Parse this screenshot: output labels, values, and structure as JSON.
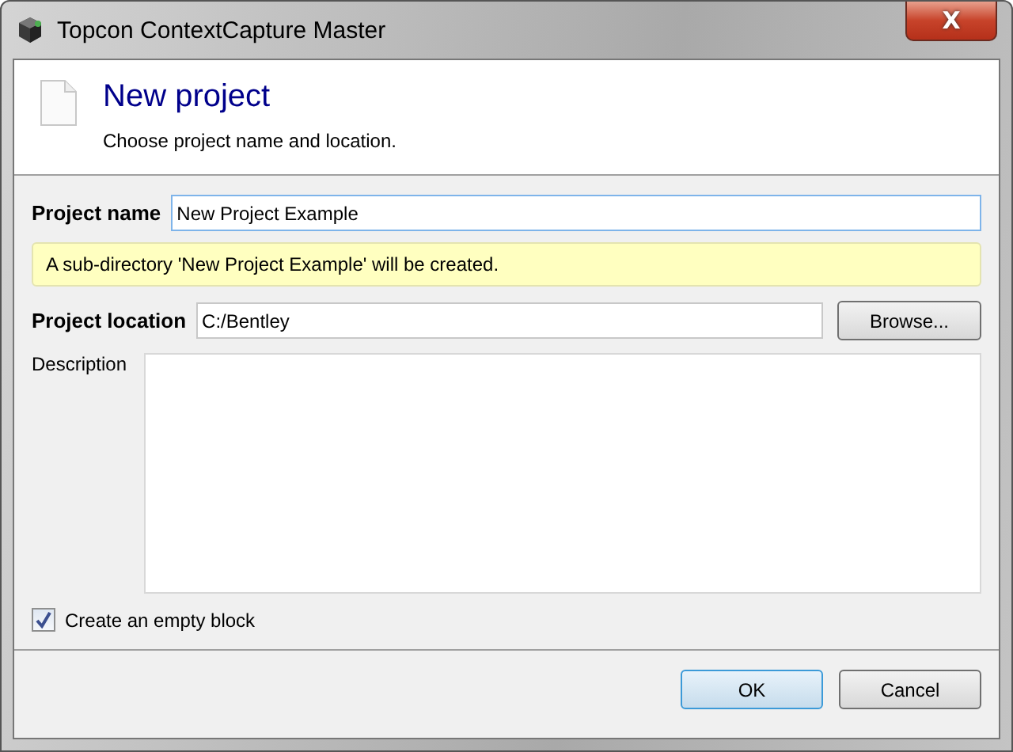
{
  "window": {
    "title": "Topcon ContextCapture Master",
    "close": "X"
  },
  "header": {
    "title": "New project",
    "subtitle": "Choose project name and location."
  },
  "project_name": {
    "label": "Project name",
    "value": "New Project Example"
  },
  "notice": "A sub-directory 'New Project Example' will be created.",
  "project_location": {
    "label": "Project location",
    "value": "C:/Bentley",
    "button": "Browse..."
  },
  "description": {
    "label": "Description"
  },
  "empty_block": {
    "label": "Create an empty block",
    "checked": true
  },
  "buttons": [
    {
      "label": "OK",
      "default": true
    },
    {
      "label": "Cancel",
      "default": false
    }
  ]
}
